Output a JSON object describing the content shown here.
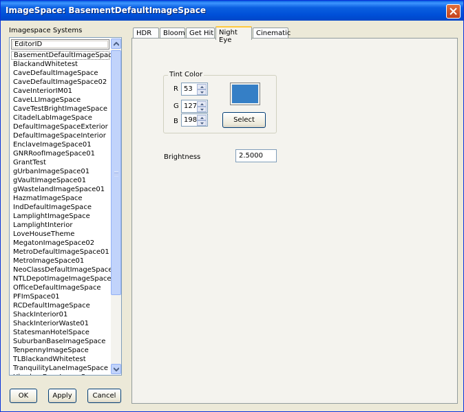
{
  "window": {
    "title": "ImageSpace: BasementDefaultImageSpace"
  },
  "sidebar": {
    "label": "Imagespace Systems",
    "column_header": "EditorID",
    "items": [
      {
        "label": "BasementDefaultImageSpace",
        "selected": true
      },
      {
        "label": "BlackandWhitetest"
      },
      {
        "label": "CaveDefaultImageSpace"
      },
      {
        "label": "CaveDefaultImageSpace02"
      },
      {
        "label": "CaveInteriorIM01"
      },
      {
        "label": "CaveLLImageSpace"
      },
      {
        "label": "CaveTestBrightImageSpace"
      },
      {
        "label": "CitadelLabImageSpace"
      },
      {
        "label": "DefaultImageSpaceExterior"
      },
      {
        "label": "DefaultImageSpaceInterior"
      },
      {
        "label": "EnclaveImageSpace01"
      },
      {
        "label": "GNRRoofImageSpace01"
      },
      {
        "label": "GrantTest"
      },
      {
        "label": "gUrbanImageSpace01"
      },
      {
        "label": "gVaultImageSpace01"
      },
      {
        "label": "gWastelandImageSpace01"
      },
      {
        "label": "HazmatImageSpace"
      },
      {
        "label": "IndDefaultImageSpace"
      },
      {
        "label": "LamplightImageSpace"
      },
      {
        "label": "LamplightInterior"
      },
      {
        "label": "LoveHouseTheme"
      },
      {
        "label": "MegatonImageSpace02"
      },
      {
        "label": "MetroDefaultImageSpace01"
      },
      {
        "label": "MetroImageSpace01"
      },
      {
        "label": "NeoClassDefaultImageSpace"
      },
      {
        "label": "NTLDepotImageImageSpace"
      },
      {
        "label": "OfficeDefaultImageSpace"
      },
      {
        "label": "PFImSpace01"
      },
      {
        "label": "RCDefaultImageSpace"
      },
      {
        "label": "ShackInterior01"
      },
      {
        "label": "ShackInteriorWaste01"
      },
      {
        "label": "StatesmanHotelSpace"
      },
      {
        "label": "SuburbanBaseImageSpace"
      },
      {
        "label": "TenpennyImageSpace"
      },
      {
        "label": "TLBlackandWhitetest"
      },
      {
        "label": "TranquilityLaneImageSpace"
      },
      {
        "label": "UburbanBaseImageSpace"
      }
    ]
  },
  "buttons": {
    "ok": "OK",
    "apply": "Apply",
    "cancel": "Cancel"
  },
  "tabs": [
    {
      "label": "HDR"
    },
    {
      "label": "Bloom"
    },
    {
      "label": "Get Hit"
    },
    {
      "label": "Night Eye",
      "active": true
    },
    {
      "label": "Cinematic"
    }
  ],
  "night_eye": {
    "tint_group_label": "Tint Color",
    "r_label": "R",
    "r_value": "53",
    "g_label": "G",
    "g_value": "127",
    "b_label": "B",
    "b_value": "198",
    "select_label": "Select",
    "swatch_color": "#357fc6",
    "brightness_label": "Brightness",
    "brightness_value": "2.5000"
  },
  "icons": {
    "close": "close-icon",
    "scroll_up": "arrow-up-icon",
    "scroll_down": "arrow-down-icon"
  }
}
